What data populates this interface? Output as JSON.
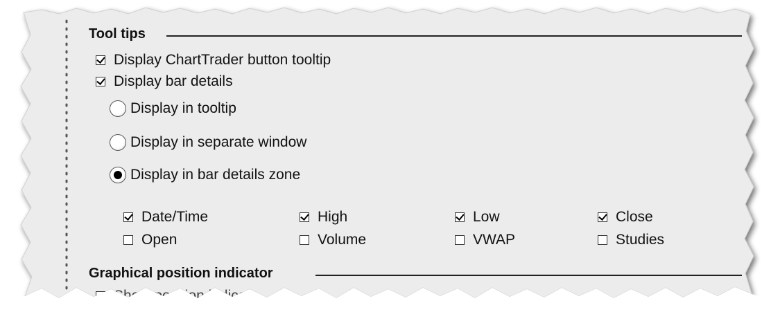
{
  "tooltips_section": {
    "title": "Tool tips",
    "chart_trader_tooltip": {
      "label": "Display ChartTrader button tooltip",
      "checked": true
    },
    "bar_details": {
      "label": "Display bar details",
      "checked": true
    },
    "display_mode": {
      "options": [
        {
          "label": "Display in tooltip",
          "selected": false
        },
        {
          "label": "Display in separate window",
          "selected": false
        },
        {
          "label": "Display in bar details zone",
          "selected": true
        }
      ]
    },
    "fields": [
      {
        "label": "Date/Time",
        "checked": true
      },
      {
        "label": "High",
        "checked": true
      },
      {
        "label": "Low",
        "checked": true
      },
      {
        "label": "Close",
        "checked": true
      },
      {
        "label": "Open",
        "checked": false
      },
      {
        "label": "Volume",
        "checked": false
      },
      {
        "label": "VWAP",
        "checked": false
      },
      {
        "label": "Studies",
        "checked": false
      }
    ]
  },
  "position_section": {
    "title": "Graphical position indicator",
    "show_indicator": {
      "label": "Show position indicat",
      "checked": true
    }
  },
  "colors": {
    "panel_background": "#ececec",
    "separator_line": "#222222",
    "dotted_border": "#555555"
  }
}
